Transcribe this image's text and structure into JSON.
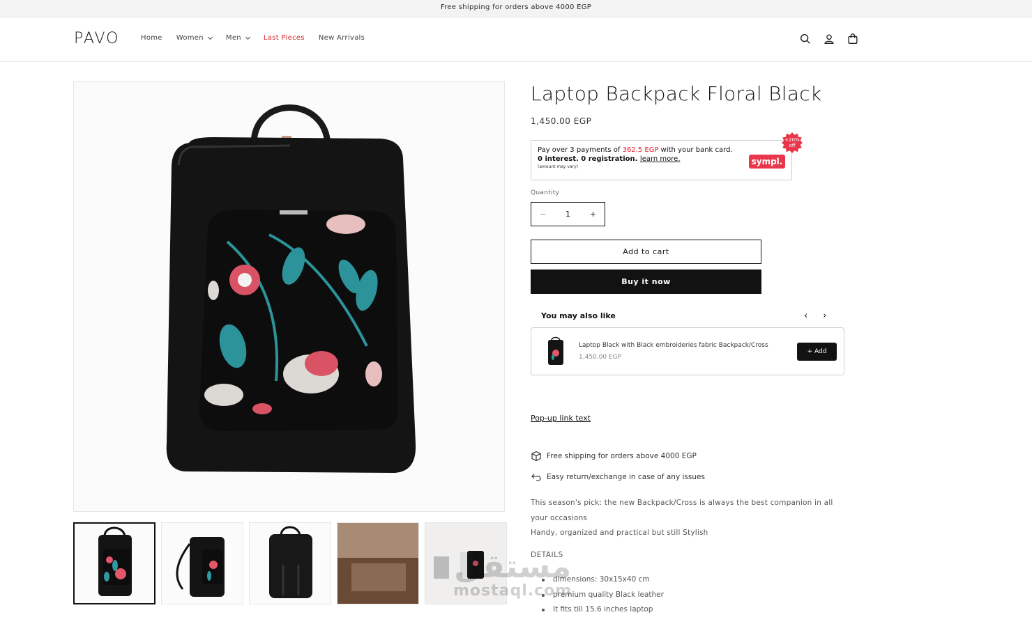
{
  "announcement": "Free shipping for orders above 4000 EGP",
  "header": {
    "logo": "PAVO",
    "nav": [
      {
        "label": "Home",
        "dropdown": false,
        "highlight": false
      },
      {
        "label": "Women",
        "dropdown": true,
        "highlight": false
      },
      {
        "label": "Men",
        "dropdown": true,
        "highlight": false
      },
      {
        "label": "Last Pieces",
        "dropdown": false,
        "highlight": true
      },
      {
        "label": "New Arrivals",
        "dropdown": false,
        "highlight": false
      }
    ],
    "icons": [
      "search-icon",
      "account-icon",
      "cart-icon"
    ]
  },
  "product": {
    "title": "Laptop Backpack Floral Black",
    "price": "1,450.00 EGP",
    "quantity_label": "Quantity",
    "quantity_value": "1",
    "minus": "−",
    "plus": "+",
    "add_to_cart": "Add to cart",
    "buy_now": "Buy it now",
    "popup_link": "Pop-up link text"
  },
  "sympl": {
    "line1_pre": "Pay over 3 payments of ",
    "amount": "362.5 EGP",
    "line1_post": " with your bank card.",
    "line2": "0 interest. 0 registration.",
    "learn_more": "learn more.",
    "note": "(amount may vary)",
    "brand": "sympl.",
    "badge": "+20% off"
  },
  "also_like": {
    "heading": "You may also like",
    "prev": "‹",
    "next": "›",
    "item": {
      "name": "Laptop Black with Black embroideries fabric Backpack/Cross",
      "price": "1,450.00 EGP",
      "add": "+  Add"
    }
  },
  "perks": [
    {
      "icon": "box-icon",
      "text": "Free shipping for orders above 4000 EGP"
    },
    {
      "icon": "return-icon",
      "text": "Easy return/exchange in case of any issues"
    }
  ],
  "description": {
    "line1": "This season's pick: the new Backpack/Cross is always the best companion in all your occasions",
    "line2": "Handy, organized and practical but still Stylish",
    "details_heading": "DETAILS",
    "details": [
      "dimensions: 30x15x40 cm",
      "premium quality Black leather",
      "It fits till 15.6 inches laptop"
    ]
  },
  "watermark": {
    "arabic": "مستقل",
    "latin": "mostaql.com"
  },
  "colors": {
    "sale": "#d7262e",
    "button_dark": "#121212",
    "sympl_red": "#e8364a",
    "sympl_amount": "#e4202f"
  }
}
